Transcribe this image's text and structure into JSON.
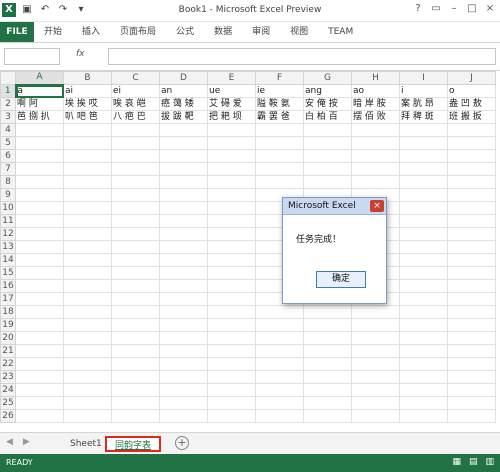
{
  "window": {
    "title": "Book1 - Microsoft Excel Preview"
  },
  "ribbon": {
    "file": "FILE",
    "tabs": [
      "开始",
      "插入",
      "页面布局",
      "公式",
      "数据",
      "审阅",
      "视图",
      "TEAM"
    ]
  },
  "columns": [
    "A",
    "B",
    "C",
    "D",
    "E",
    "F",
    "G",
    "H",
    "I",
    "J"
  ],
  "rows": [
    [
      "a",
      "ai",
      "ei",
      "an",
      "ue",
      "ie",
      "ang",
      "ao",
      "i",
      "o"
    ],
    [
      "啊 阿",
      "埃 挨 哎",
      "唉 哀 皑",
      "癌 蔼 矮",
      "艾 碍 爱",
      "隘 鞍 氨",
      "安 俺 按",
      "暗 岸 胺",
      "案 肮 昂",
      "盎 凹 敖"
    ],
    [
      "芭 捌 扒",
      "叭 吧 笆",
      "八 疤 巴",
      "拔 跋 靶",
      "把 耙 坝",
      "霸 罢 爸",
      "白 柏 百",
      "摆 佰 败",
      "拜 稗 斑",
      "班 搬 扳"
    ],
    [
      "",
      "",
      "",
      "",
      "",
      "",
      "",
      "",
      "",
      ""
    ],
    [
      "",
      "",
      "",
      "",
      "",
      "",
      "",
      "",
      "",
      ""
    ],
    [
      "",
      "",
      "",
      "",
      "",
      "",
      "",
      "",
      "",
      ""
    ],
    [
      "",
      "",
      "",
      "",
      "",
      "",
      "",
      "",
      "",
      ""
    ],
    [
      "",
      "",
      "",
      "",
      "",
      "",
      "",
      "",
      "",
      ""
    ],
    [
      "",
      "",
      "",
      "",
      "",
      "",
      "",
      "",
      "",
      ""
    ],
    [
      "",
      "",
      "",
      "",
      "",
      "",
      "",
      "",
      "",
      ""
    ]
  ],
  "dialog": {
    "title": "Microsoft Excel",
    "close": "×",
    "message": "任务完成！",
    "ok": "确定"
  },
  "sheets": [
    "Sheet1",
    "同韵字表"
  ],
  "status": {
    "ready": "READY"
  }
}
